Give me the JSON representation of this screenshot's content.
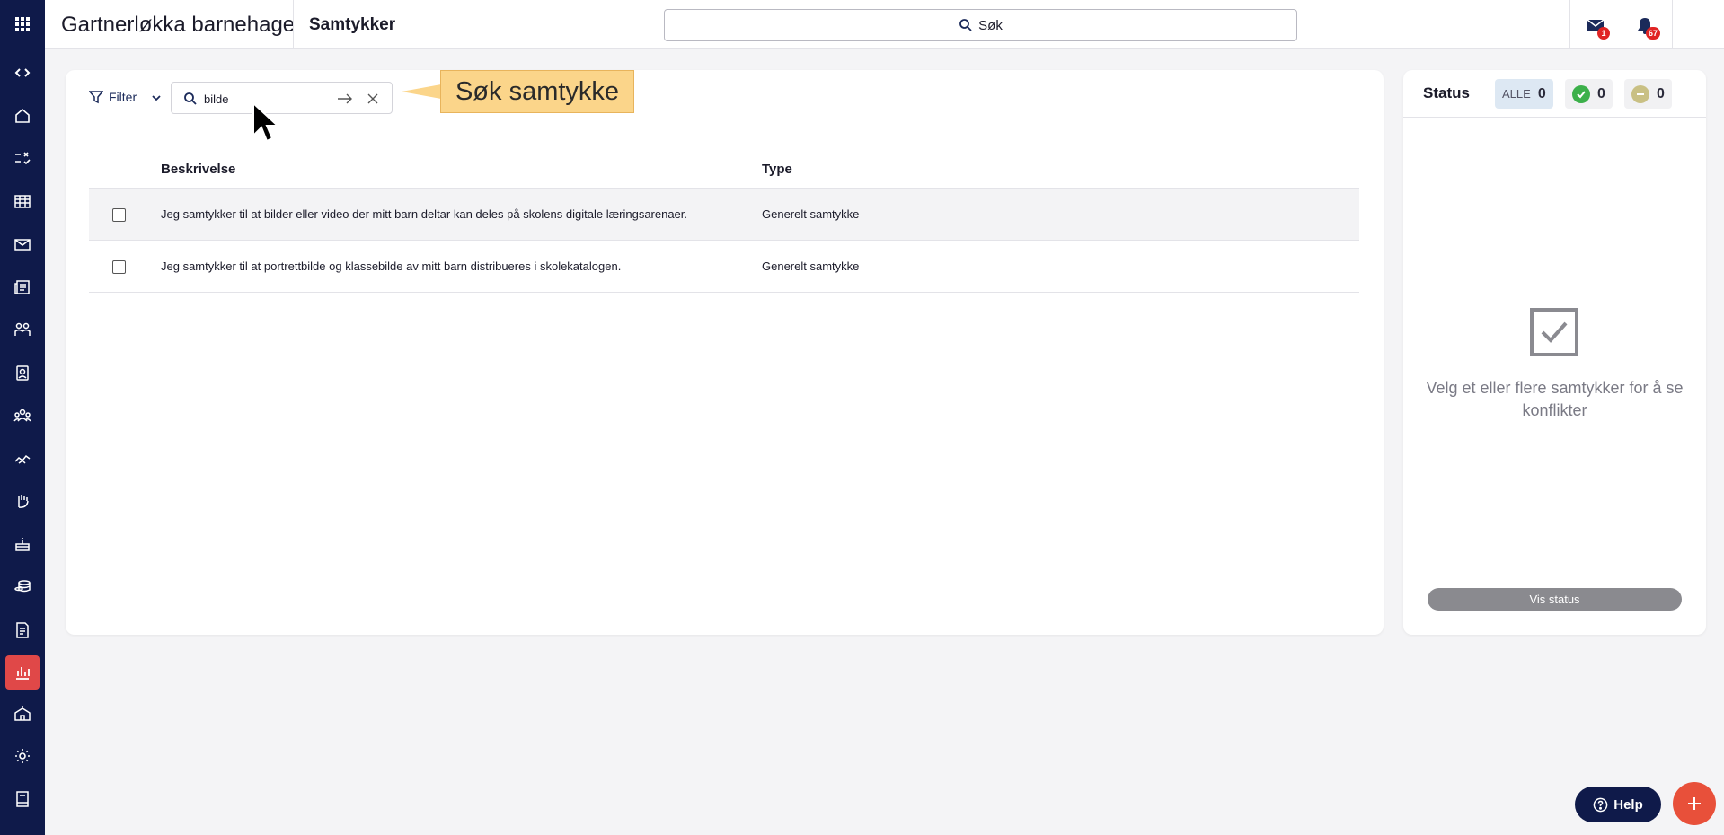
{
  "header": {
    "org_name": "Gartnerløkka barnehage",
    "page_title": "Samtykker",
    "search_label": "Søk",
    "messages_badge": "1",
    "notifications_badge": "67"
  },
  "sidebar": {
    "items": [
      {
        "icon": "code-icon"
      },
      {
        "icon": "home-icon"
      },
      {
        "icon": "tasks-icon"
      },
      {
        "icon": "calendar-icon"
      },
      {
        "icon": "mail-icon"
      },
      {
        "icon": "news-icon"
      },
      {
        "icon": "groups-icon"
      },
      {
        "icon": "badge-icon"
      },
      {
        "icon": "people-icon"
      },
      {
        "icon": "handshake-icon"
      },
      {
        "icon": "hand-icon"
      },
      {
        "icon": "cake-icon"
      },
      {
        "icon": "coins-icon"
      },
      {
        "icon": "document-icon"
      },
      {
        "icon": "chart-icon",
        "active": true
      },
      {
        "icon": "school-icon"
      },
      {
        "icon": "settings-icon"
      },
      {
        "icon": "book-icon"
      }
    ]
  },
  "toolbar": {
    "filter_label": "Filter",
    "search_value": "bilde"
  },
  "callout": {
    "text": "Søk samtykke"
  },
  "table": {
    "columns": [
      "Beskrivelse",
      "Type"
    ],
    "rows": [
      {
        "description": "Jeg samtykker til at bilder eller video der mitt barn deltar kan deles på skolens digitale læringsarenaer.",
        "type": "Generelt samtykke"
      },
      {
        "description": "Jeg samtykker til at portrettbilde og klassebilde av mitt barn distribueres i skolekatalogen.",
        "type": "Generelt samtykke"
      }
    ]
  },
  "status": {
    "title": "Status",
    "all_label": "ALLE",
    "all_count": "0",
    "approved_count": "0",
    "neutral_count": "0",
    "empty_text": "Velg et eller flere samtykker for å se konflikter",
    "button_label": "Vis status"
  },
  "help_label": "Help",
  "colors": {
    "nav_bg": "#0f1a4a",
    "active_nav": "#e04848",
    "fab": "#e8503a",
    "callout": "#fbd58a"
  }
}
